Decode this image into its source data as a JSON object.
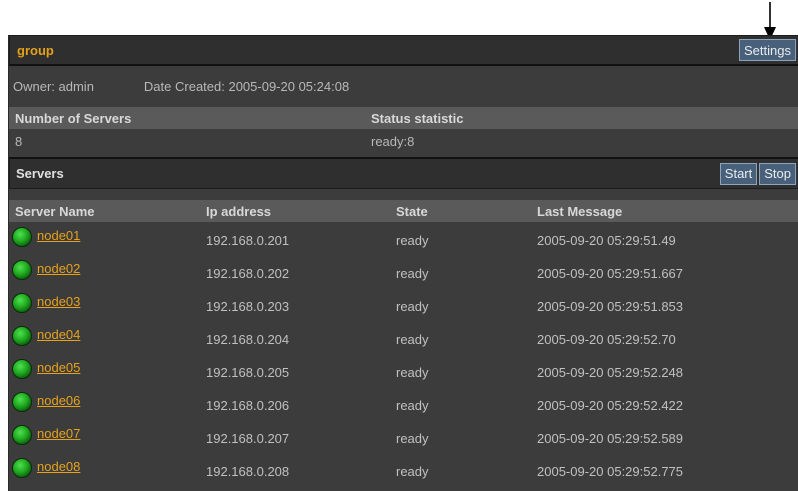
{
  "group": {
    "title": "group",
    "settings_label": "Settings"
  },
  "owner": {
    "owner_text": "Owner: admin",
    "date_text": "Date Created: 2005-09-20 05:24:08"
  },
  "stats": {
    "col_servers": "Number of Servers",
    "col_status": "Status statistic",
    "servers_count": "8",
    "status_value": "ready:8"
  },
  "servers": {
    "title": "Servers",
    "start_label": "Start",
    "stop_label": "Stop",
    "columns": [
      "Server Name",
      "Ip address",
      "State",
      "Last Message"
    ],
    "rows": [
      {
        "name": "node01",
        "ip": "192.168.0.201",
        "state": "ready",
        "last": "2005-09-20 05:29:51.49"
      },
      {
        "name": "node02",
        "ip": "192.168.0.202",
        "state": "ready",
        "last": "2005-09-20 05:29:51.667"
      },
      {
        "name": "node03",
        "ip": "192.168.0.203",
        "state": "ready",
        "last": "2005-09-20 05:29:51.853"
      },
      {
        "name": "node04",
        "ip": "192.168.0.204",
        "state": "ready",
        "last": "2005-09-20 05:29:52.70"
      },
      {
        "name": "node05",
        "ip": "192.168.0.205",
        "state": "ready",
        "last": "2005-09-20 05:29:52.248"
      },
      {
        "name": "node06",
        "ip": "192.168.0.206",
        "state": "ready",
        "last": "2005-09-20 05:29:52.422"
      },
      {
        "name": "node07",
        "ip": "192.168.0.207",
        "state": "ready",
        "last": "2005-09-20 05:29:52.589"
      },
      {
        "name": "node08",
        "ip": "192.168.0.208",
        "state": "ready",
        "last": "2005-09-20 05:29:52.775"
      }
    ]
  },
  "icons": {
    "status": "green-status-icon",
    "pointer": "down-arrow-icon"
  },
  "colors": {
    "panel_bg": "#3c3c3c",
    "accent_orange": "#e5a11a",
    "button_bg": "#48607a",
    "status_green": "#1fa81f"
  }
}
